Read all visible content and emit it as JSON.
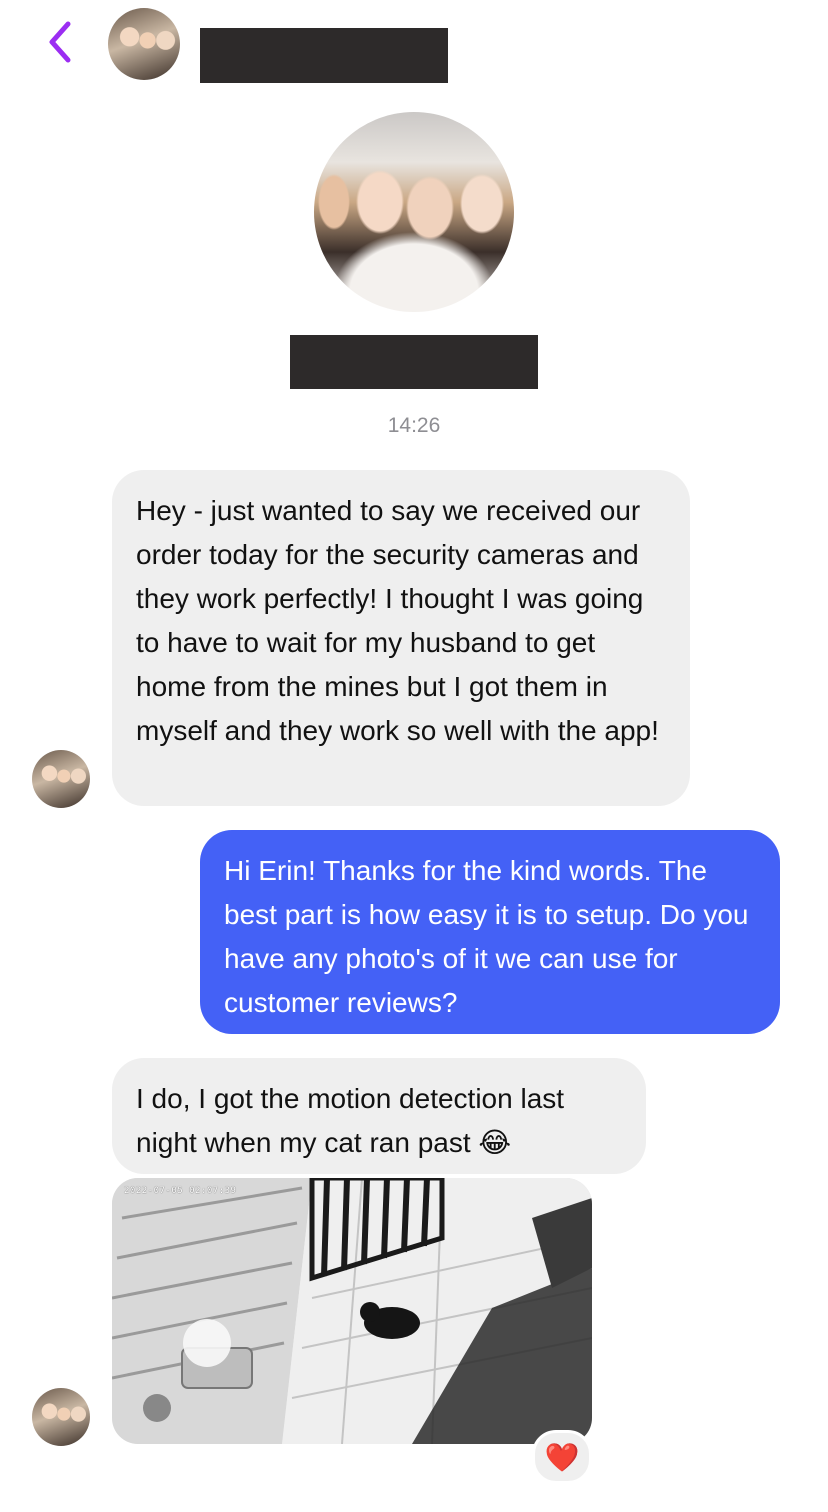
{
  "header": {
    "back_icon": "chevron-left-icon",
    "accent_color": "#9b2df2"
  },
  "conversation": {
    "timestamp": "14:26",
    "messages": [
      {
        "direction": "incoming",
        "text": "Hey - just wanted to say we received our order today for the security cameras and they work perfectly! I thought I was going to have to wait for my husband to get home from the mines but I got them in myself and they work so well with the app!"
      },
      {
        "direction": "outgoing",
        "text": "Hi Erin! Thanks for the kind words. The best part is how easy it is to setup. Do you have any photo's of it we can use for customer reviews?"
      },
      {
        "direction": "incoming",
        "text": "I do, I got the motion detection last night when my cat ran past",
        "emoji": "😂"
      },
      {
        "direction": "incoming",
        "type": "photo",
        "stamp": "2022-07-05 02:07:39",
        "reaction": "❤️"
      }
    ]
  },
  "colors": {
    "incoming_bubble": "#efefef",
    "outgoing_bubble": "#4461f6",
    "timestamp": "#8e8e93",
    "redaction": "#2d2a2a"
  }
}
